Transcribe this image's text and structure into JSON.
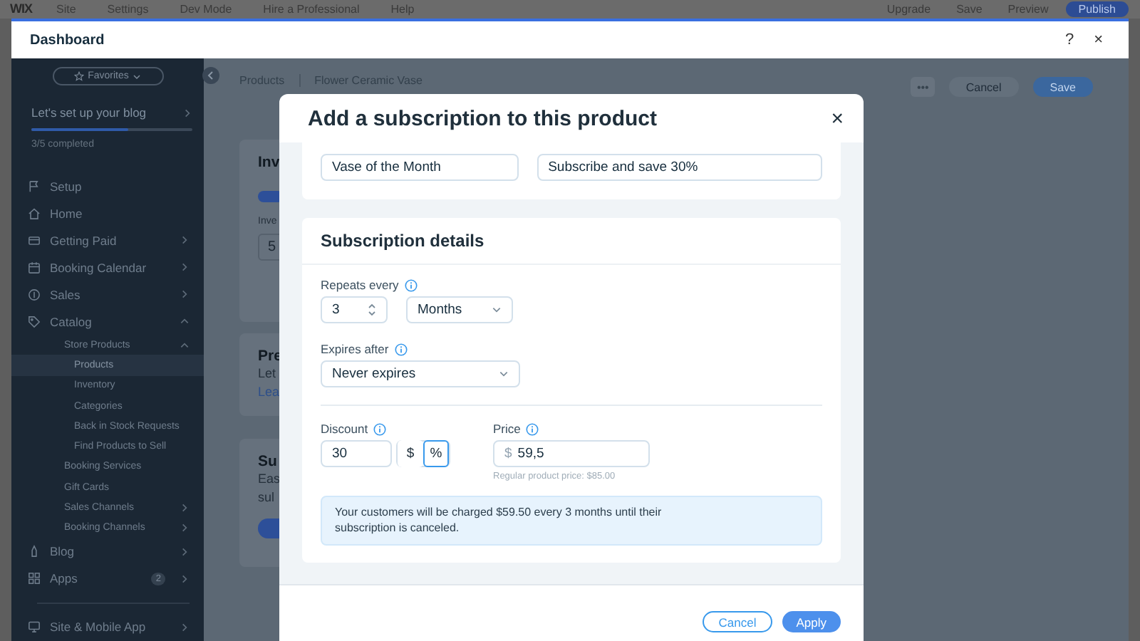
{
  "editor_bar": {
    "logo": "WIX",
    "menu": [
      "Site",
      "Settings",
      "Dev Mode",
      "Hire a Professional",
      "Help"
    ],
    "actions": [
      "Upgrade",
      "Save",
      "Preview"
    ],
    "publish": "Publish"
  },
  "window": {
    "title": "Dashboard",
    "help": "?",
    "close": "×"
  },
  "sidebar": {
    "favorites": "Favorites",
    "setup": {
      "title": "Let's set up your blog",
      "level": 0.6,
      "progress": "3/5 completed"
    },
    "items": [
      {
        "label": "Setup",
        "selected": false
      },
      {
        "label": "Home",
        "selected": false
      },
      {
        "label": "Getting Paid",
        "selected": false,
        "expanded": false
      },
      {
        "label": "Booking Calendar",
        "selected": false,
        "expanded": false
      },
      {
        "label": "Sales",
        "selected": false,
        "expanded": false
      },
      {
        "label": "Catalog",
        "selected": false,
        "expanded": true,
        "children": [
          {
            "label": "Store Products",
            "selected": false,
            "expanded": true,
            "children": [
              {
                "label": "Products",
                "selected": true
              },
              {
                "label": "Inventory",
                "selected": false
              },
              {
                "label": "Categories",
                "selected": false
              },
              {
                "label": "Back in Stock Requests",
                "selected": false
              },
              {
                "label": "Find Products to Sell",
                "selected": false
              }
            ]
          },
          {
            "label": "Booking Services",
            "selected": false
          },
          {
            "label": "Gift Cards",
            "selected": false
          },
          {
            "label": "Sales Channels",
            "selected": false,
            "expanded": false
          },
          {
            "label": "Booking Channels",
            "selected": false,
            "expanded": false
          }
        ]
      },
      {
        "label": "Blog",
        "selected": false,
        "expanded": false
      },
      {
        "label": "Apps",
        "selected": false,
        "expanded": false,
        "badge": "2"
      }
    ],
    "bottom_items": [
      {
        "label": "Site & Mobile App",
        "selected": false,
        "expanded": false
      }
    ]
  },
  "content": {
    "breadcrumb": [
      "Products",
      "Flower Ceramic Vase"
    ],
    "more": "•••",
    "cancel": "Cancel",
    "save": "Save",
    "cards": [
      {
        "title": "Inv",
        "toggle_on": true,
        "label": "Inve",
        "field_value": "5"
      },
      {
        "title": "Pre",
        "lines": [
          "Let"
        ],
        "link": "Lea"
      },
      {
        "title": "Su",
        "lines": [
          "Eas",
          "sul"
        ],
        "button": true
      }
    ]
  },
  "modal": {
    "title": "Add a subscription to this product",
    "close": "×",
    "name_fields": [
      {
        "value": "Vase of the Month"
      },
      {
        "value": "Subscribe and save 30%"
      }
    ],
    "details": {
      "title": "Subscription details",
      "repeats": {
        "label": "Repeats every",
        "value": "3",
        "unit": "Months"
      },
      "expires": {
        "label": "Expires after",
        "value": "Never expires"
      },
      "discount": {
        "label": "Discount",
        "value": "30",
        "types": [
          {
            "label": "$",
            "selected": false
          },
          {
            "label": "%",
            "selected": true
          }
        ]
      },
      "price": {
        "label": "Price",
        "currency": "$",
        "value": "59,5",
        "hint": "Regular product price: $85.00"
      },
      "notice": "Your customers will be charged $59.50 every 3 months until their subscription is canceled."
    },
    "buttons": [
      {
        "label": "Cancel",
        "kind": "secondary"
      },
      {
        "label": "Apply",
        "kind": "primary"
      }
    ]
  }
}
